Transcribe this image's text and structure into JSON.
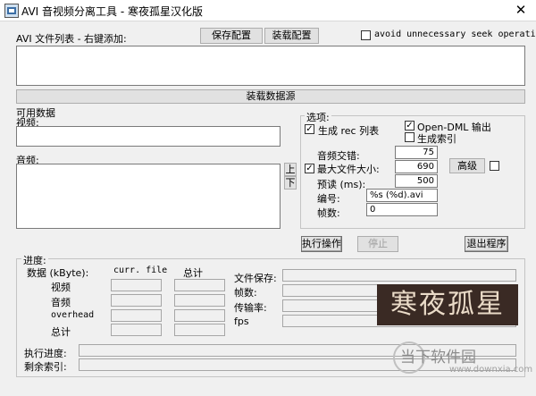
{
  "window": {
    "title": "AVI 音视频分离工具 - 寒夜孤星汉化版",
    "close": "✕"
  },
  "file_list": {
    "label": "AVI 文件列表 - 右键添加:",
    "save_config": "保存配置",
    "load_config": "装载配置",
    "avoid_seek_label": "avoid unnecessary seek operations",
    "avoid_seek_checked": false
  },
  "load_source": "装载数据源",
  "available": {
    "label": "可用数据",
    "video_label": "视频:",
    "audio_label": "音频:",
    "up": "上",
    "down": "下"
  },
  "options": {
    "title": "选项:",
    "gen_rec": {
      "label": "生成 rec 列表",
      "checked": true
    },
    "opendml": {
      "label": "Open-DML 输出",
      "checked": true
    },
    "gen_index": {
      "label": "生成索引",
      "checked": false
    },
    "audio_interleave": {
      "label": "音频交错:",
      "value": "75"
    },
    "max_file_size": {
      "label": "最大文件大小:",
      "value": "690",
      "checked": true
    },
    "preload": {
      "label": "预读 (ms):",
      "value": "500"
    },
    "numbering": {
      "label": "编号:",
      "value": "%s (%d).avi"
    },
    "frames": {
      "label": "帧数:",
      "value": "0"
    },
    "advanced": "高级",
    "advanced_checked": false
  },
  "actions": {
    "execute": "执行操作",
    "stop": "停止",
    "exit": "退出程序"
  },
  "progress": {
    "title": "进度:",
    "data_label": "数据 (kByte):",
    "col_curr": "curr. file",
    "col_total": "总计",
    "rows": [
      "视频",
      "音频",
      "overhead",
      "总计"
    ],
    "file_save": "文件保存:",
    "frames": "帧数:",
    "transfer_rate": "传输率:",
    "fps": "fps",
    "exec_progress": "执行进度:",
    "remaining_index": "剩余索引:"
  },
  "watermark": {
    "logo": "寒夜孤星",
    "site": "当下软件园",
    "url": "www.downxia.com"
  }
}
